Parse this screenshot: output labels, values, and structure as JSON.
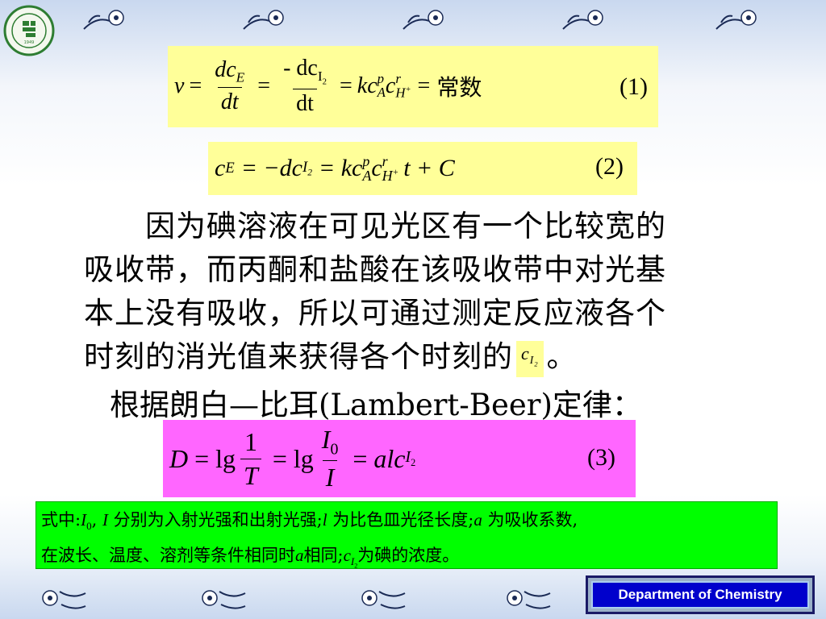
{
  "logo": {
    "text": "YANBIAN UNIVERSITY",
    "year": "1949"
  },
  "eq1": {
    "v": "v",
    "eq": "=",
    "num1_d": "dc",
    "num1_sub": "E",
    "den1": "dt",
    "num2": "- dc",
    "num2_sub": "I",
    "num2_subsub": "2",
    "den2": "dt",
    "k": "kc",
    "A": "A",
    "p": "p",
    "c": "c",
    "r": "r",
    "H": "H",
    "plus": "+",
    "const": "常数",
    "number": "(1)"
  },
  "eq2": {
    "c": "c",
    "E": "E",
    "rhs1": "= −dc",
    "I": "I",
    "two": "2",
    "rhs2": "= kc",
    "A": "A",
    "p": "p",
    "c2": "c",
    "r": "r",
    "H": "H",
    "plus": "+",
    "tail": "t + C",
    "number": "(2)"
  },
  "paragraph": {
    "line1": "　　因为碘溶液在可见光区有一个比较宽的",
    "line2": "吸收带，而丙酮和盐酸在该吸收带中对光基",
    "line3": "本上没有吸收，所以可通过测定反应液各个",
    "line4_before": "时刻的消光值来获得各个时刻的",
    "ci_c": "c",
    "ci_I": "I",
    "ci_2": "2",
    "line4_after": "。"
  },
  "law": "根据朗白—比耳(Lambert-Beer)定律：",
  "eq3": {
    "D": "D",
    "eq": "=",
    "lg": "lg",
    "one": "1",
    "T": "T",
    "I0": "I",
    "zero": "0",
    "I": "I",
    "alc": "alc",
    "subI": "I",
    "sub2": "2",
    "number": "(3)"
  },
  "note": {
    "prefix": "式中:",
    "I0": "I",
    "zero": "0",
    "comma": ",",
    "I": "I",
    "text1": " 分别为入射光强和出射光强",
    "semi1": ";",
    "l": "l",
    "text2": " 为比色皿光径长度",
    "semi2": ";",
    "a": "a",
    "text3": " 为吸收系数,",
    "line2a": "在波长、温度、溶剂等条件相同时",
    "a2": "a",
    "line2b": "相同",
    "semi3": ";",
    "c": "c",
    "subI": "I",
    "sub2": "2",
    "line2c": "为碘的浓度。"
  },
  "footer": {
    "department": "Department of Chemistry"
  }
}
